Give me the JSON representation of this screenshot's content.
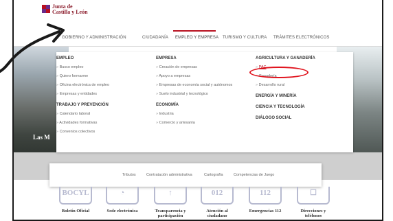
{
  "logo": {
    "line1": "Junta de",
    "line2": "Castilla y León"
  },
  "nav": [
    {
      "label": "GOBIERNO Y ADMINISTRACIÓN"
    },
    {
      "label": "CIUDADANÍA"
    },
    {
      "label": "EMPLEO Y EMPRESA"
    },
    {
      "label": "TURISMO Y CULTURA"
    },
    {
      "label": "TRÁMITES ELECTRÓNICOS"
    }
  ],
  "photo_caption": "Las M",
  "menu": {
    "col1": {
      "heading": "EMPLEO",
      "links": [
        "Busco empleo",
        "Quiero formarme",
        "Oficina electrónica de empleo",
        "Empresas y entidades"
      ],
      "heading2": "TRABAJO Y PREVENCIÓN",
      "links2": [
        "Calendario laboral",
        "Actividades formativas",
        "Convenios colectivos"
      ]
    },
    "col2": {
      "heading": "EMPRESA",
      "links": [
        "Creación de empresas",
        "Apoyo a empresas",
        "Empresas de economía social y autónomos",
        "Suelo industrial y tecnológico"
      ],
      "heading2": "ECONOMÍA",
      "links2": [
        "Industria",
        "Comercio y artesanía"
      ]
    },
    "col3": {
      "heading": "AGRICULTURA Y GANADERÍA",
      "links": [
        "PAC",
        "Ganadería",
        "Desarrollo rural"
      ],
      "heading2": "ENERGÍA Y MINERÍA",
      "heading3": "CIENCIA Y TECNOLOGÍA",
      "heading4": "DIÁLOGO SOCIAL"
    }
  },
  "tools": [
    "Tributos",
    "Contratación administrativa",
    "Cartografía",
    "Competencias de Juego"
  ],
  "tiles": [
    {
      "icon_text": "BOCYL",
      "label": "Boletín Oficial"
    },
    {
      "icon_text": "",
      "label": "Sede electrónica"
    },
    {
      "icon_text": "",
      "label": "Transparencia y participación"
    },
    {
      "icon_text": "012",
      "label": "Atención al ciudadano"
    },
    {
      "icon_text": "112",
      "label": "Emergencias 112"
    },
    {
      "icon_text": "",
      "label": "Direcciones y teléfonos"
    }
  ],
  "colors": {
    "accent": "#b8101f",
    "annotation": "#e0141e"
  }
}
